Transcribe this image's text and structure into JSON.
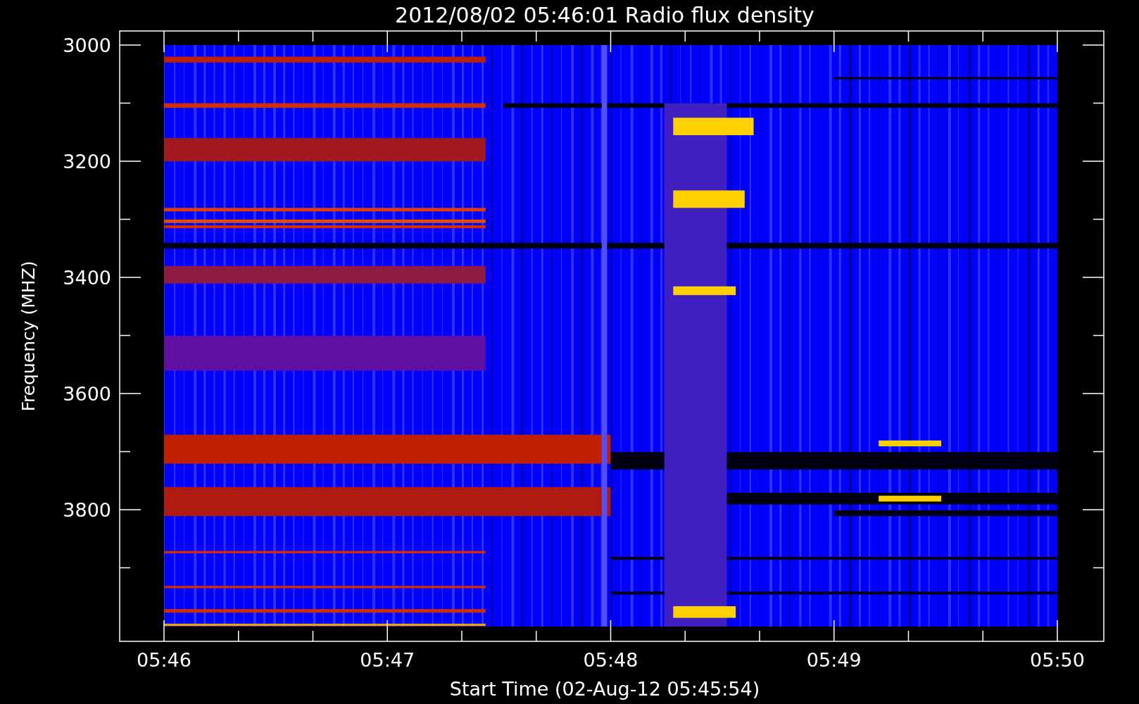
{
  "title": "2012/08/02 05:46:01 Radio flux density",
  "y_axis": {
    "label": "Frequency (MHZ)",
    "ticks": [
      "3000",
      "3200",
      "3400",
      "3600",
      "3800"
    ]
  },
  "x_axis": {
    "label": "Start Time (02-Aug-12 05:45:54)",
    "ticks": [
      "05:46",
      "05:47",
      "05:48",
      "05:49",
      "05:50"
    ]
  }
}
